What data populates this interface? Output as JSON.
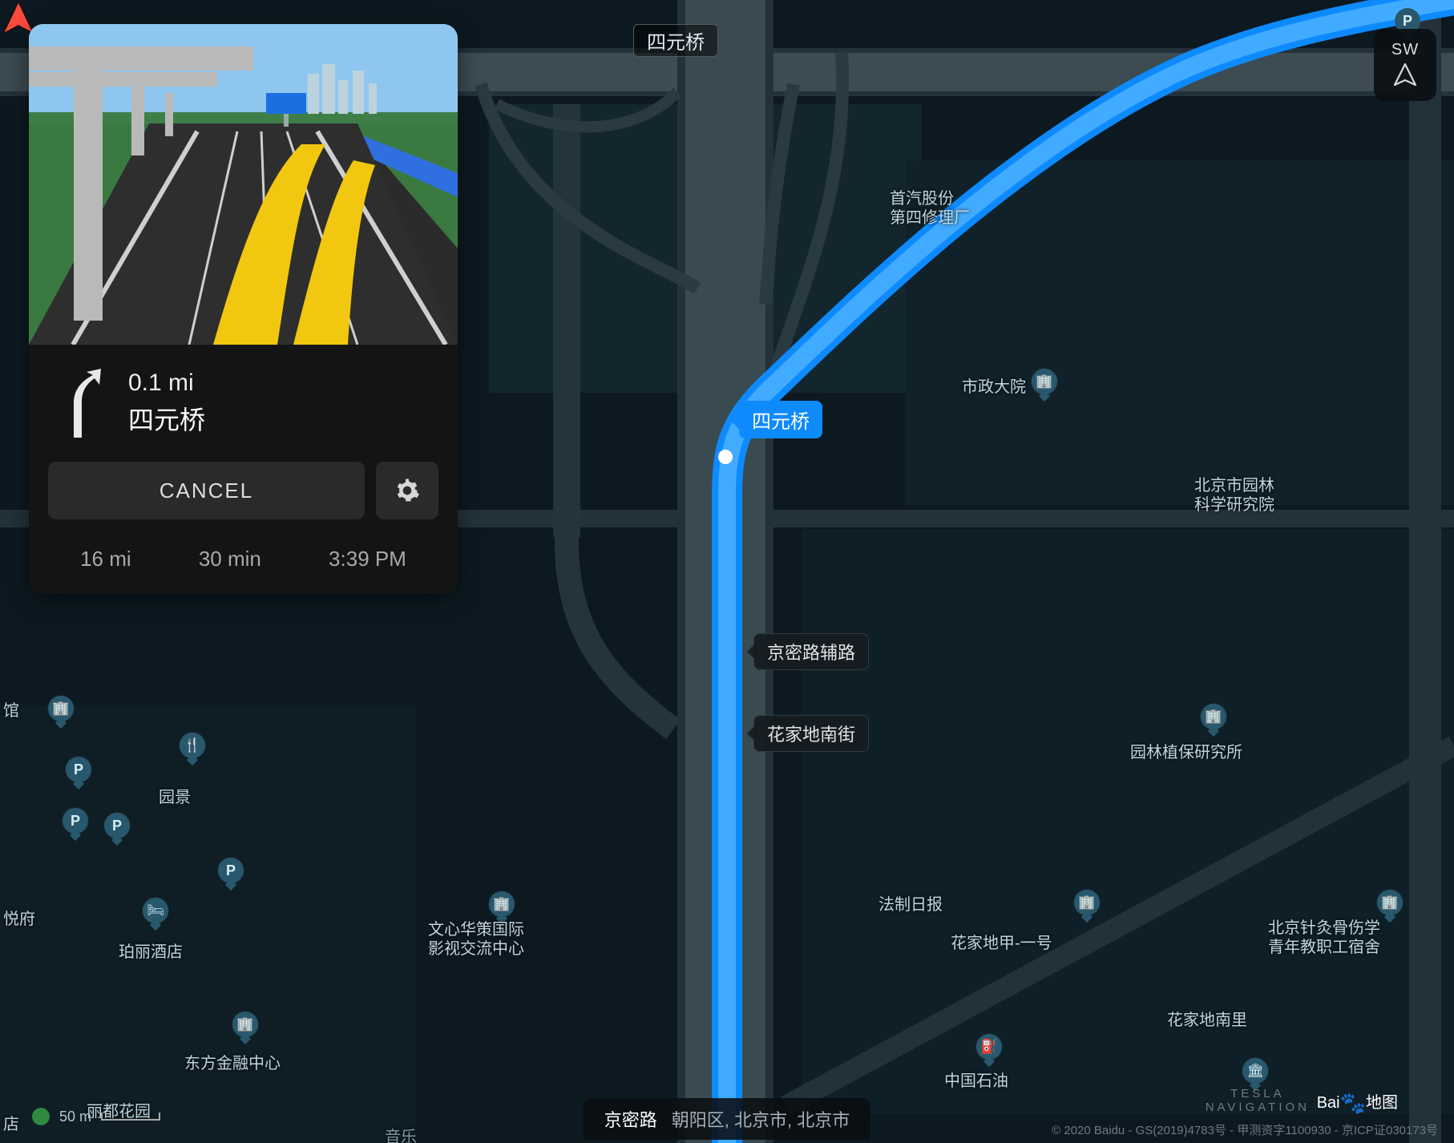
{
  "compass": {
    "direction": "SW"
  },
  "top_road": "四元桥",
  "route_exit": {
    "label": "四元桥"
  },
  "side_streets": [
    "京密路辅路",
    "花家地南街"
  ],
  "bottom_location": {
    "road": "京密路",
    "region": "朝阳区, 北京市, 北京市"
  },
  "scale": {
    "label": "50 m"
  },
  "attribution": "© 2020 Baidu - GS(2019)4783号 - 甲测资字1100930 - 京ICP证030173号",
  "brand": {
    "line1": "TESLA",
    "line2": "NAVIGATION"
  },
  "baidu_logo": {
    "prefix": "Bai",
    "suffix": "地图"
  },
  "card": {
    "maneuver": {
      "distance": "0.1 mi",
      "name": "四元桥"
    },
    "cancel": "CANCEL",
    "summary": {
      "distance": "16 mi",
      "duration": "30 min",
      "eta": "3:39 PM"
    }
  },
  "map_pois": {
    "hall": "馆",
    "yuefu": "悦府",
    "dian": "店",
    "yuanjing": "园景",
    "polijiudian": "珀丽酒店",
    "dongfang": "东方金融中心",
    "liduhy": "丽都花园",
    "wenxin": "文心华策国际\n影视交流中心",
    "shouqi": "首汽股份\n第四修理厂",
    "shizheng": "市政大院",
    "yuanlin": "北京市园林\n科学研究院",
    "yuanlinzhibao": "园林植保研究所",
    "fazhiribao": "法制日报",
    "huajiadijia": "花家地甲-一号",
    "huajiadinanli": "花家地南里",
    "zhongguoshiyou": "中国石油",
    "zhenjiu": "北京针灸骨伤学\n青年教职工宿舍",
    "yinyue": "音乐"
  }
}
